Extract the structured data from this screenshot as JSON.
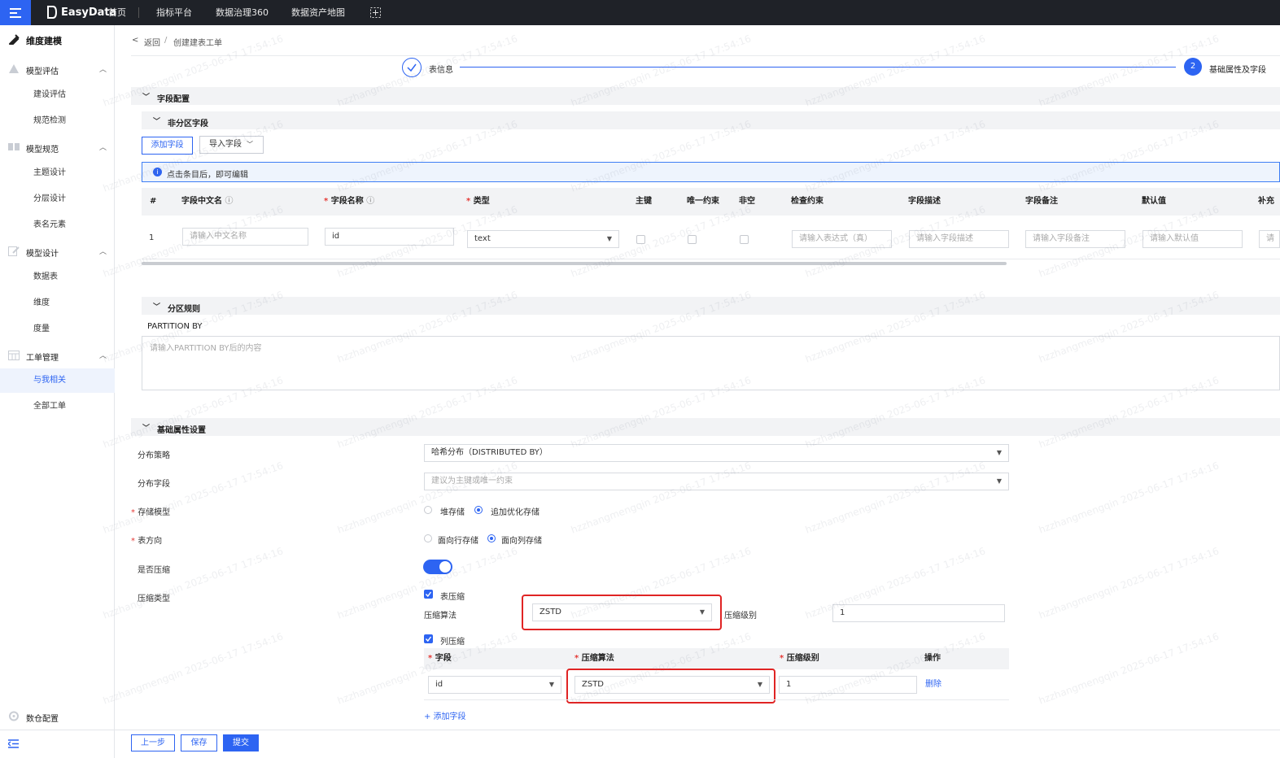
{
  "topbar": {
    "logo": "EasyData",
    "nav": [
      "首页",
      "指标平台",
      "数据治理360",
      "数据资产地图"
    ]
  },
  "sidebar": {
    "title": "维度建模",
    "groups": [
      {
        "label": "模型评估",
        "items": [
          "建设评估",
          "规范检测"
        ]
      },
      {
        "label": "模型规范",
        "items": [
          "主题设计",
          "分层设计",
          "表名元素"
        ]
      },
      {
        "label": "模型设计",
        "items": [
          "数据表",
          "维度",
          "度量"
        ]
      },
      {
        "label": "工单管理",
        "items": [
          "与我相关",
          "全部工单"
        ]
      }
    ],
    "active_item": "与我相关",
    "footer": "数仓配置"
  },
  "breadcrumb": {
    "back": "返回",
    "sep": "/",
    "current": "创建建表工单"
  },
  "steps": [
    {
      "label": "表信息",
      "state": "done"
    },
    {
      "number": "2",
      "label": "基础属性及字段",
      "state": "active"
    }
  ],
  "field_config": {
    "title": "字段配置",
    "non_partition": {
      "title": "非分区字段",
      "add_button": "添加字段",
      "import_button": "导入字段",
      "tip": "点击条目后，即可编辑",
      "columns": [
        "#",
        "字段中文名",
        "字段名称",
        "类型",
        "主键",
        "唯一约束",
        "非空",
        "检查约束",
        "字段描述",
        "字段备注",
        "默认值",
        "补充"
      ],
      "row": {
        "index": "1",
        "cn_name_placeholder": "请输入中文名称",
        "name": "id",
        "type": "text",
        "check_placeholder": "请输入表达式（真）",
        "desc_placeholder": "请输入字段描述",
        "note_placeholder": "请输入字段备注",
        "default_placeholder": "请输入默认值",
        "extra_placeholder": "请"
      }
    },
    "partition": {
      "title": "分区规则",
      "label": "PARTITION BY",
      "placeholder": "请输入PARTITION BY后的内容"
    }
  },
  "basic": {
    "title": "基础属性设置",
    "distribution_label": "分布策略",
    "distribution_value": "哈希分布（DISTRIBUTED BY）",
    "dist_field_label": "分布字段",
    "dist_field_placeholder": "建议为主键或唯一约束",
    "storage_label": "存储模型",
    "storage_options": [
      "堆存储",
      "追加优化存储"
    ],
    "storage_selected": 1,
    "orientation_label": "表方向",
    "orientation_options": [
      "面向行存储",
      "面向列存储"
    ],
    "orientation_selected": 1,
    "compress_label": "是否压缩",
    "compress_on": true,
    "compress_type_label": "压缩类型",
    "table_compress": {
      "label": "表压缩",
      "checked": true,
      "algo_label": "压缩算法",
      "algo": "ZSTD",
      "level_label": "压缩级别",
      "level": "1"
    },
    "col_compress": {
      "label": "列压缩",
      "checked": true,
      "headers": [
        "字段",
        "压缩算法",
        "压缩级别",
        "操作"
      ],
      "row": {
        "field": "id",
        "algo": "ZSTD",
        "level": "1",
        "action": "删除"
      },
      "add": "+ 添加字段"
    }
  },
  "footer": {
    "prev": "上一步",
    "save": "保存",
    "submit": "提交"
  },
  "watermark": "hzzhangmengqin 2025-06-17 17:54:16",
  "colors": {
    "primary": "#2d64f2",
    "topbar": "#1f2228",
    "highlight": "#e02424"
  }
}
